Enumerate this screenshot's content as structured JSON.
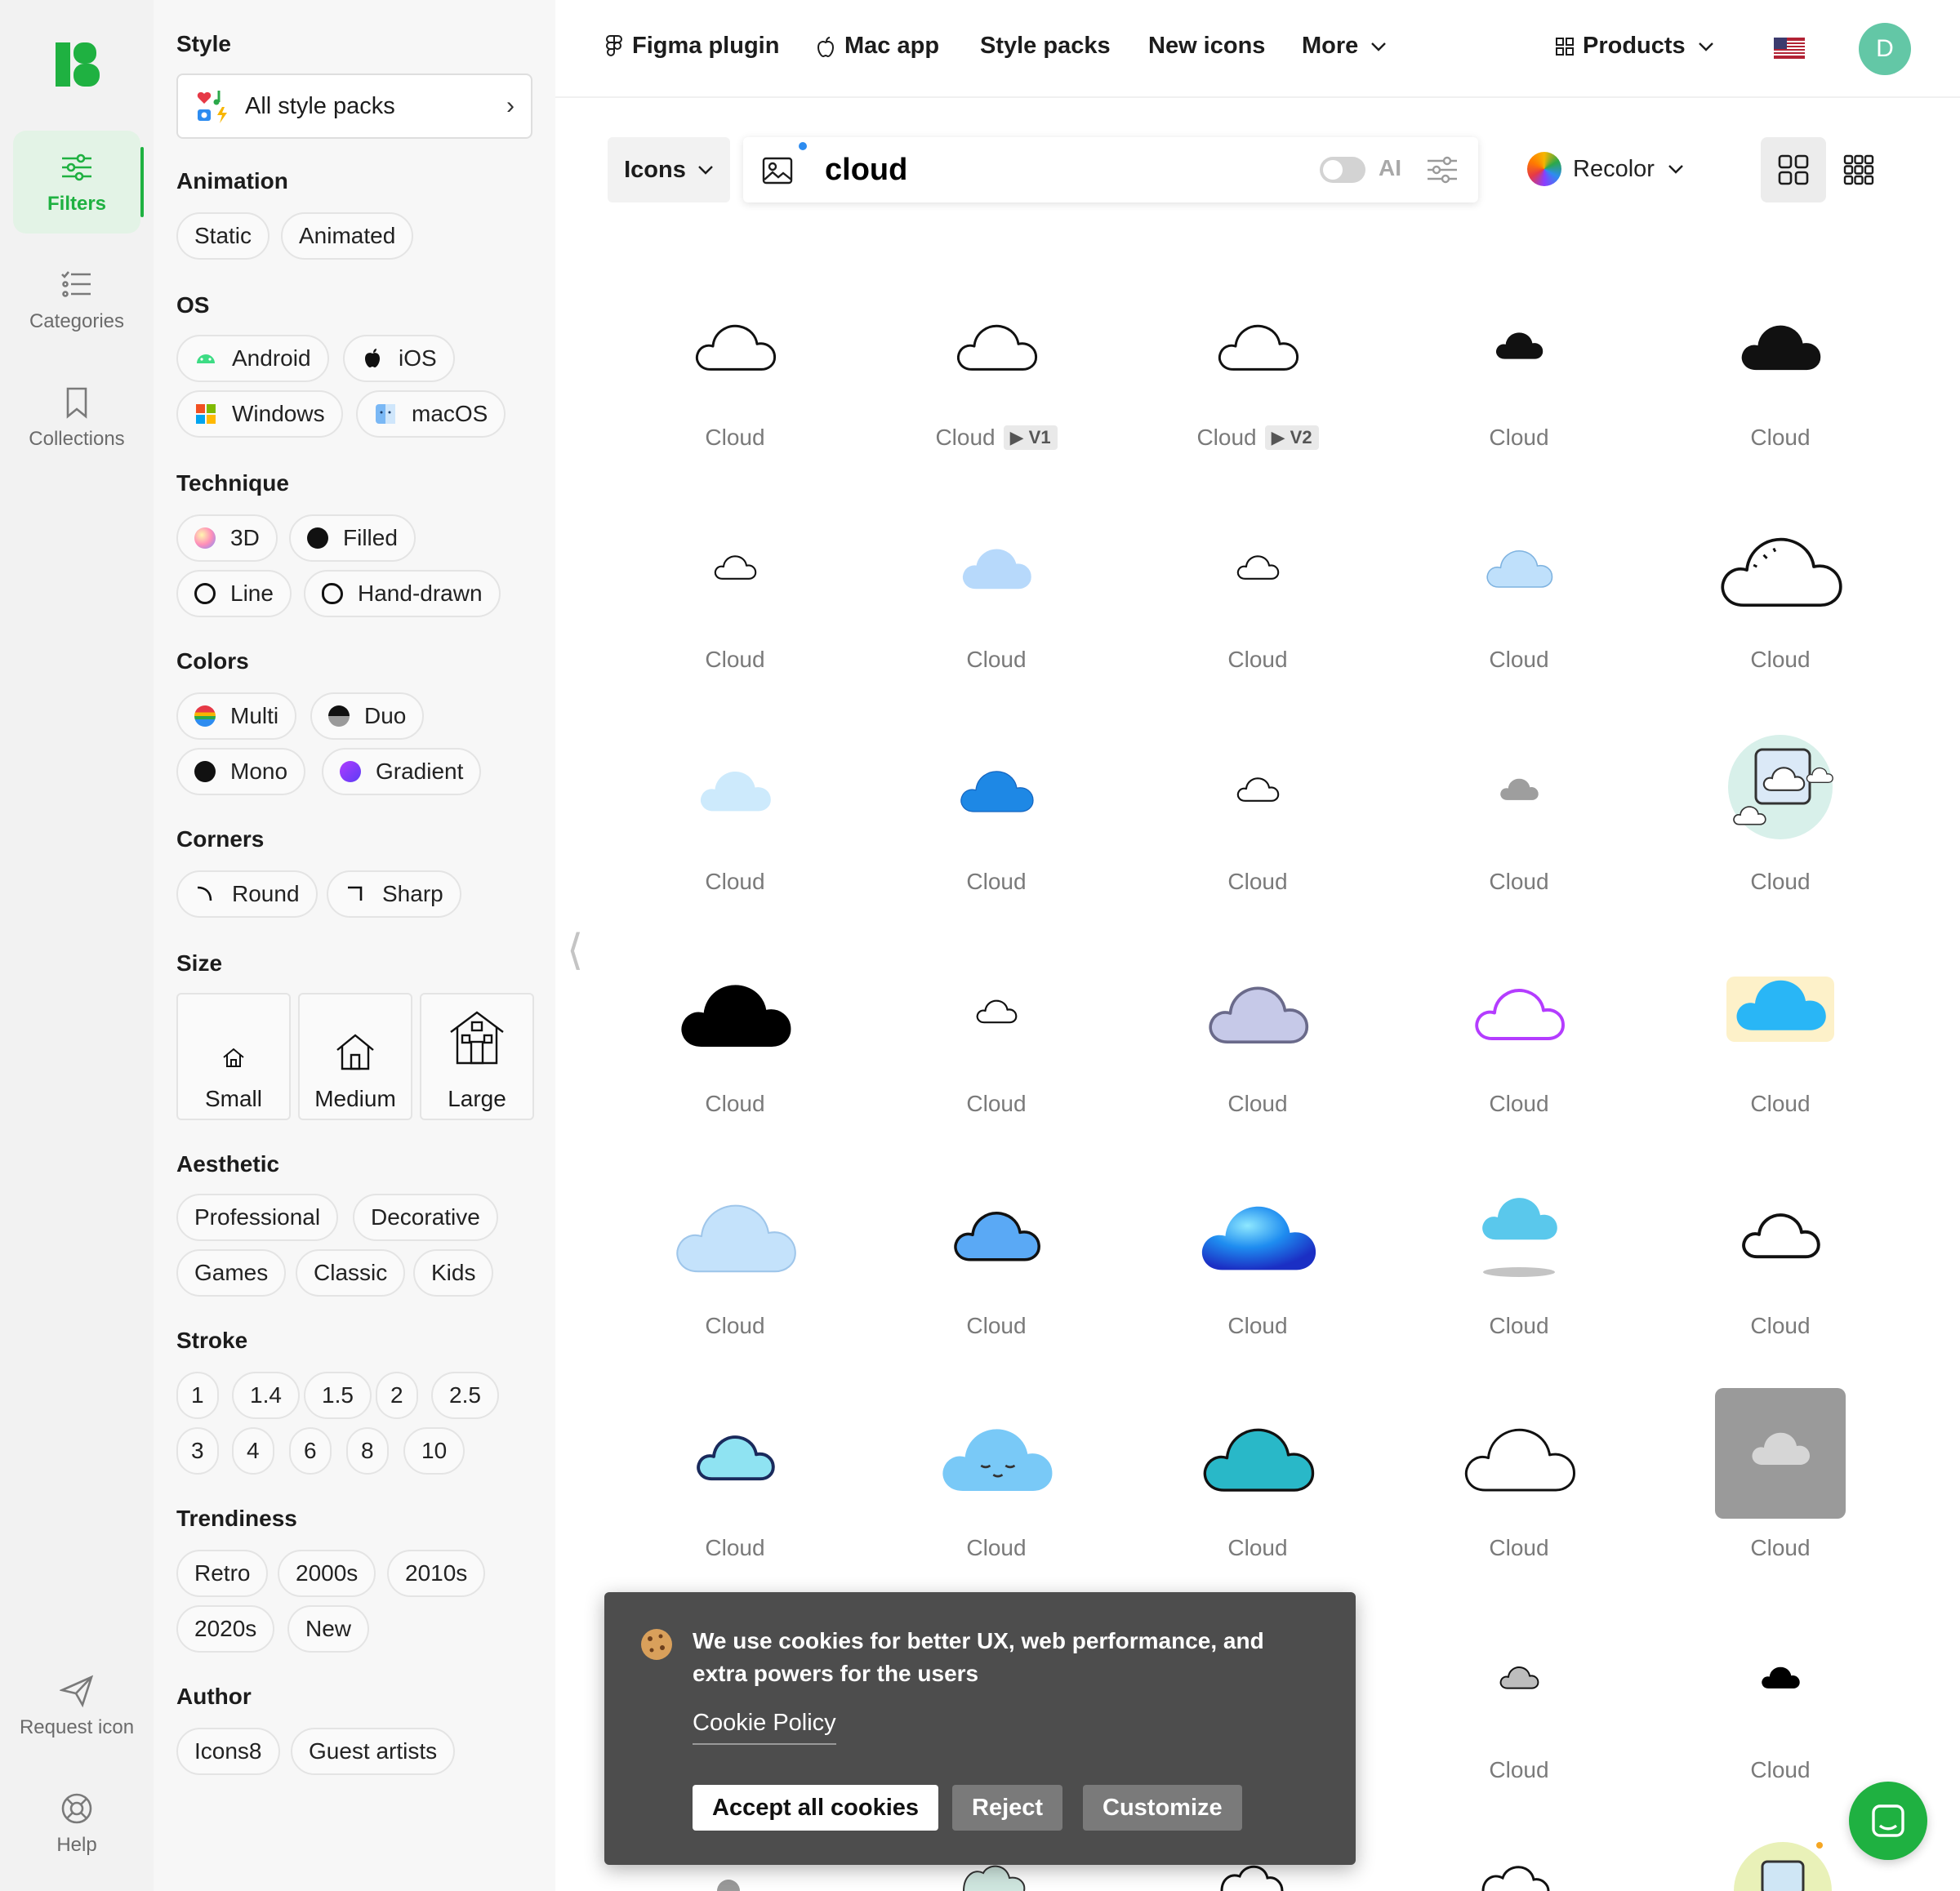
{
  "rail": {
    "items": [
      {
        "label": "Filters",
        "icon": "sliders-icon"
      },
      {
        "label": "Categories",
        "icon": "list-icon"
      },
      {
        "label": "Collections",
        "icon": "bookmark-icon"
      }
    ],
    "bottom": [
      {
        "label": "Request icon",
        "icon": "paper-plane-icon"
      },
      {
        "label": "Help",
        "icon": "lifebuoy-icon"
      }
    ]
  },
  "filters": {
    "style_title": "Style",
    "style_pack": "All style packs",
    "animation": {
      "title": "Animation",
      "options": [
        "Static",
        "Animated"
      ]
    },
    "os": {
      "title": "OS",
      "options": [
        "Android",
        "iOS",
        "Windows",
        "macOS"
      ]
    },
    "technique": {
      "title": "Technique",
      "options": [
        "3D",
        "Filled",
        "Line",
        "Hand-drawn"
      ]
    },
    "colors": {
      "title": "Colors",
      "options": [
        "Multi",
        "Duo",
        "Mono",
        "Gradient"
      ]
    },
    "corners": {
      "title": "Corners",
      "options": [
        "Round",
        "Sharp"
      ]
    },
    "size": {
      "title": "Size",
      "options": [
        "Small",
        "Medium",
        "Large"
      ]
    },
    "aesthetic": {
      "title": "Aesthetic",
      "options": [
        "Professional",
        "Decorative",
        "Games",
        "Classic",
        "Kids"
      ]
    },
    "stroke": {
      "title": "Stroke",
      "options": [
        "1",
        "1.4",
        "1.5",
        "2",
        "2.5",
        "3",
        "4",
        "6",
        "8",
        "10"
      ]
    },
    "trendiness": {
      "title": "Trendiness",
      "options": [
        "Retro",
        "2000s",
        "2010s",
        "2020s",
        "New"
      ]
    },
    "author": {
      "title": "Author",
      "options": [
        "Icons8",
        "Guest artists"
      ]
    }
  },
  "topnav": {
    "links": [
      "Figma plugin",
      "Mac app",
      "Style packs",
      "New icons",
      "More"
    ],
    "products": "Products",
    "avatar_initial": "D"
  },
  "search": {
    "type": "Icons",
    "query": "cloud",
    "ai_label": "AI",
    "ai_enabled": false,
    "recolor": "Recolor"
  },
  "results": {
    "label": "Cloud",
    "badges": {
      "1": "V1",
      "2": "V2"
    },
    "icons": [
      "outline-thin",
      "outline-thin",
      "outline-thin",
      "filled-small",
      "filled",
      "outline-tiny",
      "fluffy-lightblue",
      "outline-tiny",
      "pastel-blue",
      "sketch-outline",
      "gradient-lightblue",
      "blue-3d",
      "outline-tiny",
      "gray-small",
      "framed-sticker",
      "filled-large",
      "cartoon-tiny",
      "lavender-doodle",
      "neon-purple",
      "blue-splash",
      "pale-blue-large",
      "blue-sticker",
      "glossy-3d",
      "cyan-shadow",
      "hand-drawn-line",
      "navy-cyan",
      "kawaii-face",
      "teal-line",
      "sketch-white",
      "gray-tile",
      "hidden",
      "hidden",
      "hidden",
      "gray-small-outline",
      "filled-tiny"
    ]
  },
  "cookie": {
    "message": "We use cookies for better UX, web performance, and extra powers for the users",
    "policy": "Cookie Policy",
    "accept": "Accept all cookies",
    "reject": "Reject",
    "customize": "Customize"
  },
  "colors": {
    "accent": "#1fb141",
    "avatar": "#63c7a6",
    "cookie_bg": "#4d4d4d"
  }
}
